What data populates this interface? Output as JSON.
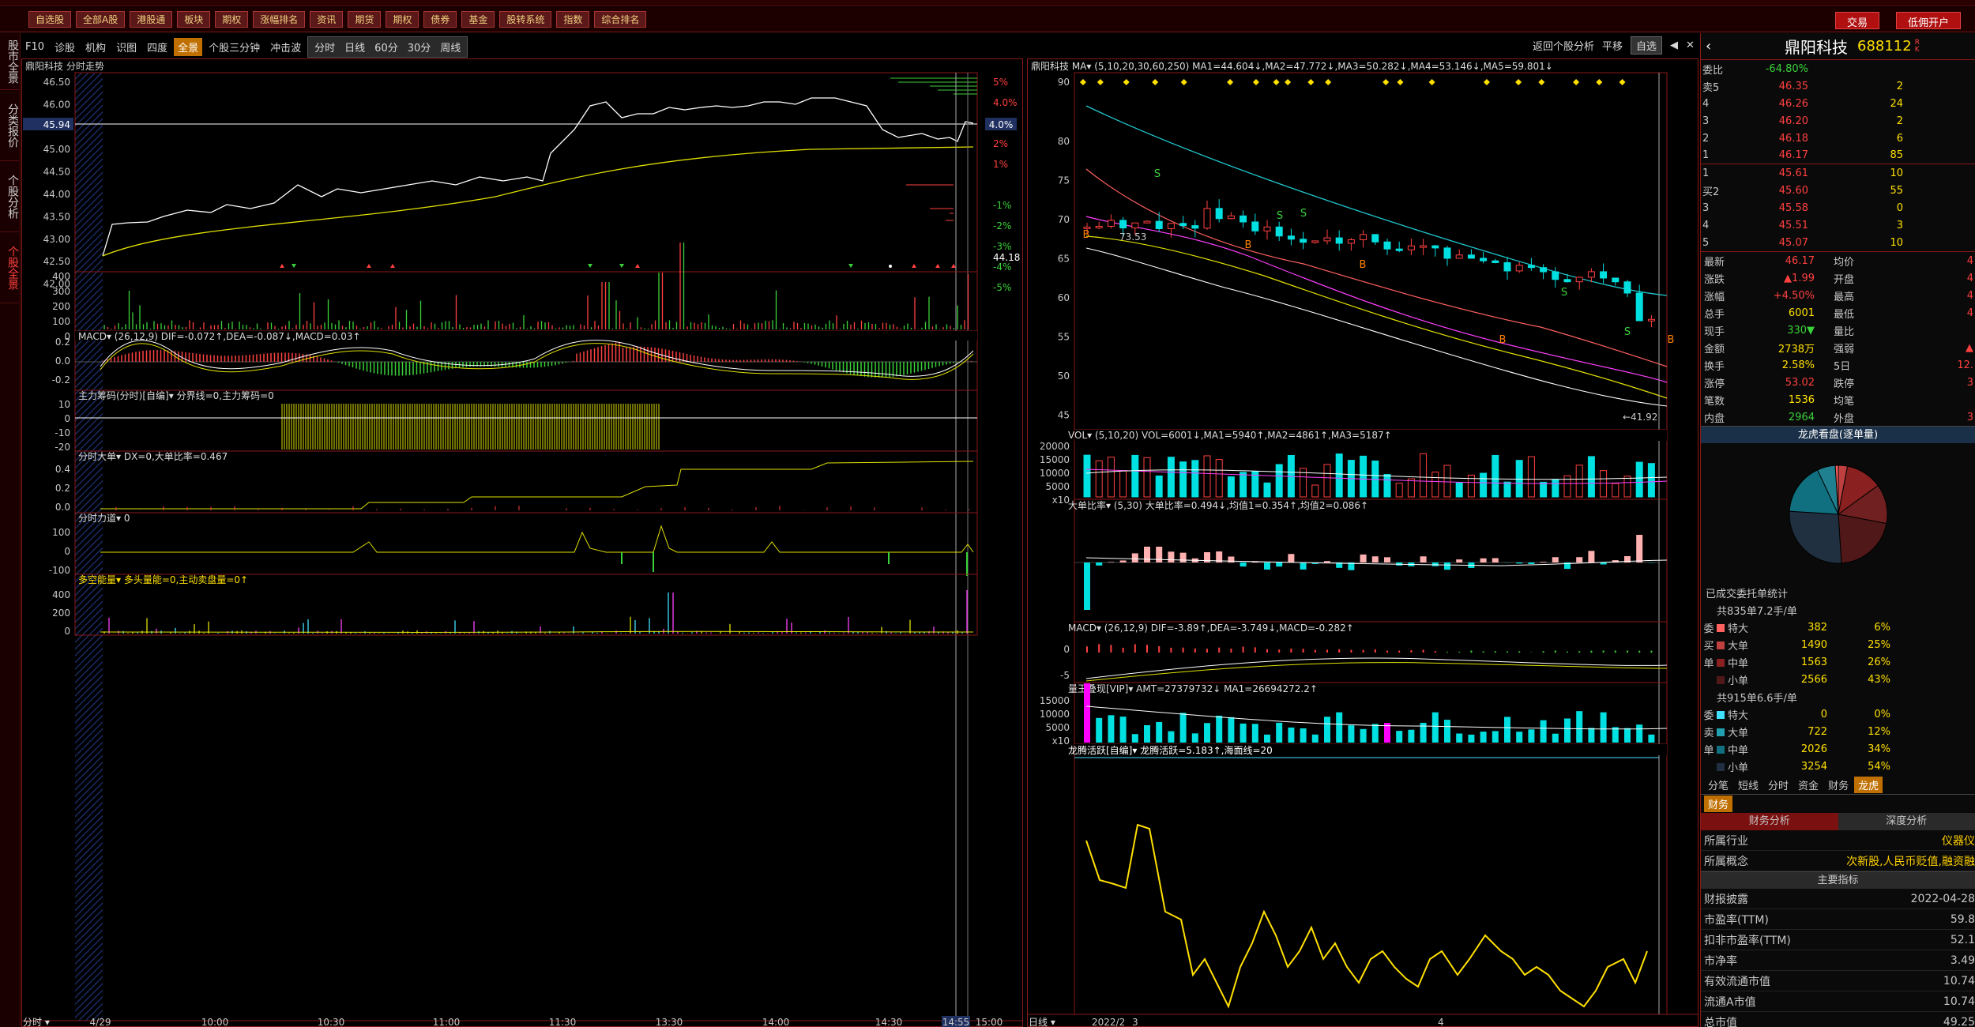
{
  "menu": [
    "自选股",
    "全部A股",
    "港股通",
    "板块",
    "期权",
    "涨幅排名",
    "资讯",
    "期货",
    "期权",
    "债券",
    "基金",
    "股转系统",
    "指数",
    "综合排名"
  ],
  "menu_right": {
    "trade": "交易",
    "open_account": "低佣开户"
  },
  "sidebar": [
    "股市全景",
    "分类报价",
    "个股分析",
    "个股全景"
  ],
  "toolbar": {
    "items": [
      "F10",
      "诊股",
      "机构",
      "识图",
      "四度",
      "全景",
      "个股三分钟",
      "冲击波"
    ],
    "selected": "全景",
    "periods": [
      "分时",
      "日线",
      "60分",
      "30分",
      "周线"
    ]
  },
  "toolbar_right": {
    "back": "返回个股分析",
    "flat": "平移",
    "watch": "自选"
  },
  "intraday": {
    "title": "鼎阳科技 分时走势",
    "price_ticks": [
      "46.50",
      "46.00",
      "45.50",
      "45.00",
      "44.50",
      "44.00",
      "43.50",
      "43.00",
      "42.50",
      "42.00"
    ],
    "pct_ticks": [
      "5%",
      "4.0%",
      "3%",
      "2%",
      "1%",
      "",
      "-1%",
      "-2%",
      "-3%",
      "-4%",
      "-5%"
    ],
    "current_price": "45.94",
    "current_pct": "4.0%",
    "base_price": "44.18",
    "vol_ticks": [
      "400",
      "300",
      "200",
      "100",
      "0"
    ],
    "macd_title": "MACD▾ (26,12,9) DIF=-0.072↑,DEA=-0.087↓,MACD=0.03↑",
    "macd_ticks": [
      "0.2",
      "0.0",
      "-0.2"
    ],
    "chips_title": "主力筹码(分时)[自编]▾ 分界线=0,主力筹码=0",
    "chips_ticks": [
      "10",
      "0",
      "-10",
      "-20"
    ],
    "bigorder_title": "分时大单▾ DX=0,大单比率=0.467",
    "bigorder_ticks": [
      "0.4",
      "0.2",
      "0.0"
    ],
    "force_title": "分时力道▾ 0",
    "force_ticks": [
      "100",
      "0",
      "-100"
    ],
    "energy_title": "多空能量▾ 多头量能=0,主动卖盘量=0↑",
    "energy_ticks": [
      "400",
      "200",
      "0"
    ],
    "time_label": "分时",
    "time_ticks": [
      "4/29",
      "10:00",
      "10:30",
      "11:00",
      "11:30",
      "13:30",
      "14:00",
      "14:30",
      "14:55",
      "15:00"
    ]
  },
  "kline": {
    "title": "鼎阳科技 MA▾ (5,10,20,30,60,250) MA1=44.604↓,MA2=47.772↓,MA3=50.282↓,MA4=53.146↓,MA5=59.801↓",
    "y_ticks": [
      "90",
      "80",
      "75",
      "70",
      "65",
      "60",
      "55",
      "50",
      "45"
    ],
    "hi_label": "73.53",
    "lo_label": "41.92",
    "vol_title": "VOL▾ (5,10,20) VOL=6001↓,MA1=5940↑,MA2=4861↑,MA3=5187↑",
    "vol_ticks": [
      "20000",
      "15000",
      "10000",
      "5000",
      "x10"
    ],
    "ratio_title": "大单比率▾ (5,30) 大单比率=0.494↓,均值1=0.354↑,均值2=0.086↑",
    "macd_title": "MACD▾ (26,12,9) DIF=-3.89↑,DEA=-3.749↓,MACD=-0.282↑",
    "macd_ticks": [
      "0",
      "-5"
    ],
    "amt_title": "量王叠现[VIP]▾ AMT=27379732↓ MA1=26694272.2↑",
    "amt_ticks": [
      "15000",
      "10000",
      "5000",
      "x10"
    ],
    "dragon_title": "龙腾活跃[自编]▾ 龙腾活跃=5.183↑,海面线=20",
    "period_label": "日线",
    "time_ticks": [
      "2022/2",
      "3",
      "4"
    ]
  },
  "quote": {
    "name": "鼎阳科技",
    "code": "688112",
    "weibi_label": "委比",
    "weibi": "-64.80%",
    "asks": [
      [
        "卖5",
        "46.35",
        "2"
      ],
      [
        "4",
        "46.26",
        "24"
      ],
      [
        "3",
        "46.20",
        "2"
      ],
      [
        "2",
        "46.18",
        "6"
      ],
      [
        "1",
        "46.17",
        "85"
      ]
    ],
    "bids": [
      [
        "1",
        "45.61",
        "10"
      ],
      [
        "买2",
        "45.60",
        "55"
      ],
      [
        "3",
        "45.58",
        "0"
      ],
      [
        "4",
        "45.51",
        "3"
      ],
      [
        "5",
        "45.07",
        "10"
      ]
    ],
    "stats": [
      [
        "最新",
        "46.17",
        "均价",
        "4"
      ],
      [
        "涨跌",
        "▲1.99",
        "开盘",
        "4"
      ],
      [
        "涨幅",
        "+4.50%",
        "最高",
        "4"
      ],
      [
        "总手",
        "6001",
        "最低",
        "4"
      ],
      [
        "现手",
        "330▼",
        "量比",
        ""
      ],
      [
        "金额",
        "2738万",
        "强弱",
        "▲"
      ],
      [
        "换手",
        "2.58%",
        "5日",
        "12."
      ],
      [
        "涨停",
        "53.02",
        "跌停",
        "3"
      ],
      [
        "笔数",
        "1536",
        "均笔",
        ""
      ],
      [
        "内盘",
        "2964",
        "外盘",
        "3"
      ]
    ],
    "dragon_header": "龙虎看盘(逐单量)",
    "pie_colors": [
      "#c04040",
      "#8a2020",
      "#702020",
      "#501818",
      "#203040",
      "#107080",
      "#208090",
      "#ff6060"
    ],
    "order_stat_label": "已成交委托单统计",
    "buy_summary": "共835单7.2手/单",
    "buy_rows": [
      [
        "委",
        "特大",
        "382",
        "6%"
      ],
      [
        "买",
        "大单",
        "1490",
        "25%"
      ],
      [
        "单",
        "中单",
        "1563",
        "26%"
      ],
      [
        "",
        "小单",
        "2566",
        "43%"
      ]
    ],
    "sell_summary": "共915单6.6手/单",
    "sell_rows": [
      [
        "委",
        "特大",
        "0",
        "0%"
      ],
      [
        "卖",
        "大单",
        "722",
        "12%"
      ],
      [
        "单",
        "中单",
        "2026",
        "34%"
      ],
      [
        "",
        "小单",
        "3254",
        "54%"
      ]
    ],
    "tabs": [
      "分笔",
      "短线",
      "分时",
      "资金",
      "财务",
      "龙虎"
    ],
    "tab_on": "龙虎",
    "fin_tab": "财务",
    "fin_header_left": "财务分析",
    "fin_header_right": "深度分析",
    "fin_rows": [
      [
        "所属行业",
        "仪器仪"
      ],
      [
        "所属概念",
        "次新股,人民币贬值,融资融"
      ]
    ],
    "main_index": "主要指标",
    "fin_rows2": [
      [
        "财报披露",
        "2022-04-28"
      ],
      [
        "市盈率(TTM)",
        "59.8"
      ],
      [
        "扣非市盈率(TTM)",
        "52.1"
      ],
      [
        "市净率",
        "3.49"
      ],
      [
        "有效流通市值",
        "10.74"
      ],
      [
        "流通A市值",
        "10.74"
      ],
      [
        "总市值",
        "49.25"
      ]
    ]
  },
  "colors": {
    "up": "#ff4040",
    "down": "#00e0e0",
    "yellow": "#ffe000",
    "border": "#8a1818"
  }
}
